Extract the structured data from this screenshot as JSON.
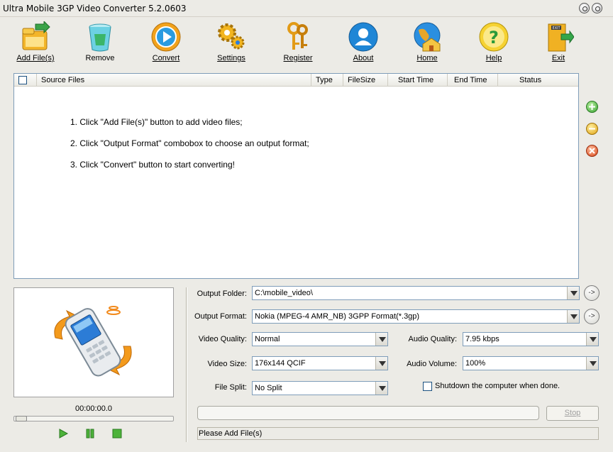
{
  "window": {
    "title": "Ultra Mobile 3GP Video Converter 5.2.0603"
  },
  "toolbar": {
    "items": [
      {
        "label": "Add File(s)",
        "icon": "add-files-icon"
      },
      {
        "label": "Remove",
        "icon": "recycle-bin-icon"
      },
      {
        "label": "Convert",
        "icon": "play-convert-icon"
      },
      {
        "label": "Settings",
        "icon": "gears-icon"
      },
      {
        "label": "Register",
        "icon": "keys-icon"
      },
      {
        "label": "About",
        "icon": "user-icon"
      },
      {
        "label": "Home",
        "icon": "globe-home-icon"
      },
      {
        "label": "Help",
        "icon": "question-icon"
      },
      {
        "label": "Exit",
        "icon": "exit-door-icon"
      }
    ]
  },
  "filelist": {
    "columns": [
      "Source Files",
      "Type",
      "FileSize",
      "Start Time",
      "End Time",
      "Status"
    ],
    "instructions": [
      "1. Click \"Add File(s)\" button to add video files;",
      "2. Click \"Output Format\" combobox to choose an output format;",
      "3. Click \"Convert\" button to start converting!"
    ]
  },
  "player": {
    "timecode": "00:00:00.0"
  },
  "settings": {
    "output_folder_label": "Output Folder:",
    "output_folder_value": "C:\\mobile_video\\",
    "output_format_label": "Output Format:",
    "output_format_value": "Nokia (MPEG-4 AMR_NB) 3GPP Format(*.3gp)",
    "video_quality_label": "Video Quality:",
    "video_quality_value": "Normal",
    "audio_quality_label": "Audio Quality:",
    "audio_quality_value": "7.95  kbps",
    "video_size_label": "Video Size:",
    "video_size_value": "176x144   QCIF",
    "audio_volume_label": "Audio Volume:",
    "audio_volume_value": "100%",
    "file_split_label": "File Split:",
    "file_split_value": "No Split",
    "shutdown_label": "Shutdown the computer when done.",
    "go_button_label": "->"
  },
  "actions": {
    "stop_label": "Stop"
  },
  "status": {
    "text": "Please Add File(s)"
  }
}
